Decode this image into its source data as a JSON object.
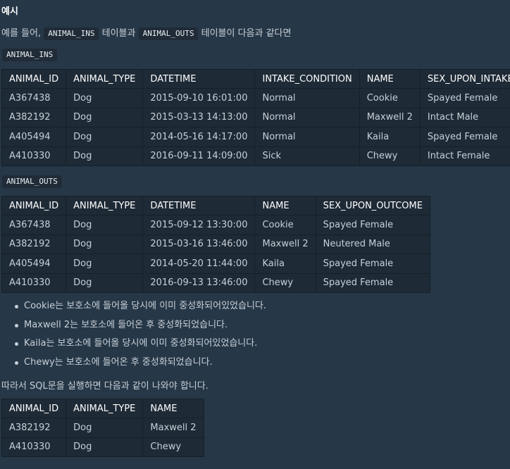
{
  "heading": "예시",
  "intro": {
    "before": "예를 들어,",
    "code1": "ANIMAL_INS",
    "middle": "테이블과",
    "code2": "ANIMAL_OUTS",
    "after": "테이블이 다음과 같다면"
  },
  "ins": {
    "label": "ANIMAL_INS",
    "headers": [
      "ANIMAL_ID",
      "ANIMAL_TYPE",
      "DATETIME",
      "INTAKE_CONDITION",
      "NAME",
      "SEX_UPON_INTAKE"
    ],
    "rows": [
      [
        "A367438",
        "Dog",
        "2015-09-10 16:01:00",
        "Normal",
        "Cookie",
        "Spayed Female"
      ],
      [
        "A382192",
        "Dog",
        "2015-03-13 14:13:00",
        "Normal",
        "Maxwell 2",
        "Intact Male"
      ],
      [
        "A405494",
        "Dog",
        "2014-05-16 14:17:00",
        "Normal",
        "Kaila",
        "Spayed Female"
      ],
      [
        "A410330",
        "Dog",
        "2016-09-11 14:09:00",
        "Sick",
        "Chewy",
        "Intact Female"
      ]
    ]
  },
  "outs": {
    "label": "ANIMAL_OUTS",
    "headers": [
      "ANIMAL_ID",
      "ANIMAL_TYPE",
      "DATETIME",
      "NAME",
      "SEX_UPON_OUTCOME"
    ],
    "rows": [
      [
        "A367438",
        "Dog",
        "2015-09-12 13:30:00",
        "Cookie",
        "Spayed Female"
      ],
      [
        "A382192",
        "Dog",
        "2015-03-16 13:46:00",
        "Maxwell 2",
        "Neutered Male"
      ],
      [
        "A405494",
        "Dog",
        "2014-05-20 11:44:00",
        "Kaila",
        "Spayed Female"
      ],
      [
        "A410330",
        "Dog",
        "2016-09-13 13:46:00",
        "Chewy",
        "Spayed Female"
      ]
    ]
  },
  "bullets": [
    "Cookie는 보호소에 들어올 당시에 이미 중성화되어있었습니다.",
    "Maxwell 2는 보호소에 들어온 후 중성화되었습니다.",
    "Kaila는 보호소에 들어올 당시에 이미 중성화되어있었습니다.",
    "Chewy는 보호소에 들어온 후 중성화되었습니다."
  ],
  "conclusion": "따라서 SQL문을 실행하면 다음과 같이 나와야 합니다.",
  "result": {
    "headers": [
      "ANIMAL_ID",
      "ANIMAL_TYPE",
      "NAME"
    ],
    "rows": [
      [
        "A382192",
        "Dog",
        "Maxwell 2"
      ],
      [
        "A410330",
        "Dog",
        "Chewy"
      ]
    ]
  }
}
